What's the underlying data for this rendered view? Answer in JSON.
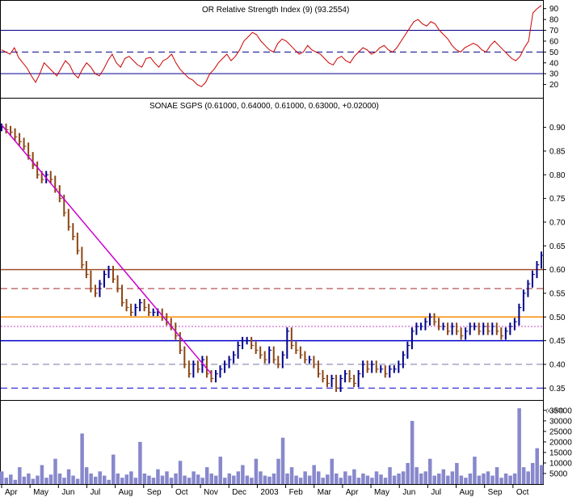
{
  "chart_data": [
    {
      "type": "line",
      "panel": "indicator",
      "title": "OR Relative Strength Index (9) (93.2554)",
      "yticks": [
        20,
        30,
        40,
        50,
        60,
        70,
        80,
        90
      ],
      "ylim": [
        10,
        95
      ],
      "levels": [
        {
          "value": 70,
          "style": "solid",
          "color": "#00008b"
        },
        {
          "value": 50,
          "style": "dashed",
          "color": "#00008b"
        },
        {
          "value": 30,
          "style": "solid",
          "color": "#00008b"
        }
      ],
      "series": [
        {
          "color": "#cc0000",
          "values": [
            52,
            50,
            48,
            54,
            45,
            40,
            35,
            28,
            22,
            30,
            40,
            36,
            32,
            28,
            35,
            42,
            38,
            30,
            26,
            34,
            40,
            36,
            30,
            28,
            34,
            42,
            48,
            40,
            36,
            44,
            46,
            42,
            38,
            36,
            44,
            45,
            40,
            36,
            42,
            44,
            48,
            40,
            34,
            30,
            26,
            24,
            20,
            18,
            22,
            30,
            34,
            40,
            44,
            48,
            42,
            46,
            52,
            60,
            64,
            68,
            66,
            60,
            56,
            52,
            50,
            58,
            62,
            60,
            56,
            52,
            48,
            50,
            56,
            52,
            50,
            48,
            44,
            40,
            38,
            44,
            46,
            42,
            40,
            46,
            50,
            54,
            52,
            48,
            50,
            54,
            56,
            52,
            50,
            54,
            60,
            66,
            72,
            78,
            80,
            76,
            74,
            78,
            76,
            70,
            66,
            62,
            56,
            52,
            50,
            54,
            56,
            58,
            56,
            52,
            50,
            56,
            60,
            56,
            52,
            48,
            44,
            42,
            46,
            54,
            60,
            86,
            90,
            93
          ]
        }
      ]
    },
    {
      "type": "ohlc",
      "panel": "price",
      "title": "SONAE SGPS (0.61000, 0.64000, 0.61000, 0.63000, +0.02000)",
      "x": [
        "Apr",
        "May",
        "Jun",
        "Jul",
        "Aug",
        "Sep",
        "Oct",
        "Nov",
        "Dec",
        "2003",
        "Feb",
        "Mar",
        "Apr",
        "May",
        "Jun",
        "Jul",
        "Aug",
        "Sep",
        "Oct"
      ],
      "yticks": [
        0.35,
        0.4,
        0.45,
        0.5,
        0.55,
        0.6,
        0.65,
        0.7,
        0.75,
        0.8,
        0.85,
        0.9
      ],
      "ytick_labels": [
        "0.35",
        "0.40",
        "0.45",
        "0.50",
        "0.55",
        "0.60",
        "0.65",
        "0.70",
        "0.75",
        "0.80",
        "0.85",
        "0.90"
      ],
      "ylim": [
        0.33,
        0.93
      ],
      "levels": [
        {
          "value": 0.6,
          "style": "solid",
          "color": "#a0522d"
        },
        {
          "value": 0.56,
          "style": "dashed",
          "color": "#a52a2a"
        },
        {
          "value": 0.5,
          "style": "solid",
          "color": "#ff8c00"
        },
        {
          "value": 0.48,
          "style": "dotted",
          "color": "#cc44cc"
        },
        {
          "value": 0.45,
          "style": "solid",
          "color": "#0000cd"
        },
        {
          "value": 0.4,
          "style": "dashed",
          "color": "#7777aa"
        },
        {
          "value": 0.35,
          "style": "dashed",
          "color": "#0000cd"
        }
      ],
      "trendline": {
        "color": "#cc00cc",
        "start": {
          "x": 0,
          "y": 0.905
        },
        "end": {
          "x": 47,
          "y": 0.38
        }
      },
      "closes": [
        0.9,
        0.895,
        0.89,
        0.88,
        0.87,
        0.86,
        0.84,
        0.82,
        0.8,
        0.79,
        0.8,
        0.79,
        0.77,
        0.75,
        0.72,
        0.69,
        0.67,
        0.64,
        0.61,
        0.59,
        0.56,
        0.55,
        0.57,
        0.59,
        0.6,
        0.58,
        0.56,
        0.53,
        0.52,
        0.51,
        0.52,
        0.53,
        0.52,
        0.51,
        0.51,
        0.51,
        0.5,
        0.49,
        0.48,
        0.46,
        0.43,
        0.4,
        0.38,
        0.4,
        0.39,
        0.41,
        0.38,
        0.37,
        0.38,
        0.39,
        0.4,
        0.41,
        0.42,
        0.44,
        0.45,
        0.45,
        0.44,
        0.43,
        0.42,
        0.41,
        0.43,
        0.41,
        0.4,
        0.42,
        0.47,
        0.44,
        0.43,
        0.42,
        0.41,
        0.41,
        0.4,
        0.38,
        0.37,
        0.36,
        0.37,
        0.35,
        0.37,
        0.38,
        0.37,
        0.36,
        0.38,
        0.4,
        0.39,
        0.4,
        0.39,
        0.39,
        0.38,
        0.39,
        0.39,
        0.4,
        0.42,
        0.44,
        0.47,
        0.48,
        0.48,
        0.49,
        0.5,
        0.49,
        0.48,
        0.48,
        0.47,
        0.48,
        0.47,
        0.46,
        0.47,
        0.48,
        0.48,
        0.47,
        0.48,
        0.47,
        0.48,
        0.47,
        0.46,
        0.47,
        0.48,
        0.49,
        0.52,
        0.55,
        0.57,
        0.59,
        0.61,
        0.63
      ]
    },
    {
      "type": "bar",
      "panel": "volume",
      "yticks": [
        5000,
        10000,
        15000,
        20000,
        25000,
        30000,
        35000
      ],
      "ytick_labels": [
        "5000",
        "10000",
        "15000",
        "20000",
        "25000",
        "30000",
        "35000"
      ],
      "unit_label": "(x 1000)",
      "ylim": [
        0,
        38000
      ],
      "bar_color": "#8888cc",
      "values": [
        6000,
        3000,
        4500,
        2000,
        8000,
        3500,
        5000,
        2500,
        4000,
        9000,
        3000,
        4500,
        12000,
        5000,
        3000,
        7000,
        4000,
        2500,
        24000,
        8000,
        5000,
        3500,
        6000,
        4000,
        2000,
        14000,
        5000,
        3000,
        4500,
        6000,
        3000,
        20000,
        5000,
        4000,
        3000,
        7000,
        4000,
        6000,
        3000,
        5000,
        11000,
        4000,
        3000,
        6000,
        4500,
        3000,
        8000,
        5000,
        4000,
        13000,
        3000,
        5000,
        4000,
        6000,
        9000,
        4000,
        3000,
        12000,
        6000,
        4000,
        3500,
        5000,
        12000,
        22000,
        5000,
        8000,
        4000,
        3000,
        6000,
        4000,
        9000,
        6000,
        3000,
        4500,
        12000,
        5000,
        3000,
        6000,
        4000,
        7000,
        3000,
        5000,
        4000,
        3000,
        6000,
        4500,
        3000,
        8000,
        4000,
        5000,
        6000,
        10000,
        30000,
        8000,
        5000,
        6000,
        12000,
        4000,
        5000,
        7000,
        4000,
        6000,
        10000,
        4000,
        3000,
        5000,
        13000,
        4000,
        5000,
        6000,
        4000,
        8000,
        3000,
        5000,
        4000,
        5000,
        36000,
        8000,
        6000,
        10000,
        17000,
        9000
      ]
    }
  ]
}
